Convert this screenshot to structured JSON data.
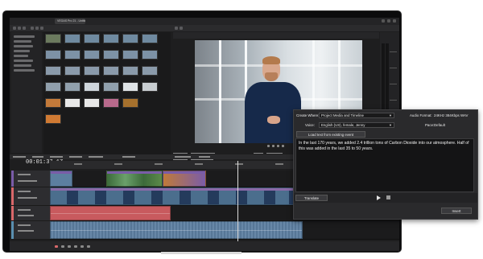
{
  "app": {
    "tab_title": "VEGAS Pro 21 - Untitled *"
  },
  "timeline": {
    "timecode": "00:01:37,17"
  },
  "tts_dialog": {
    "create_where_label": "Create Where:",
    "create_where_value": "Project Media and Timeline",
    "voice_label": "Voice:",
    "voice_value": "English (US), female, Jenny",
    "audio_format_label": "Audio Format:",
    "audio_format_value": "24KHz 384Kbps WAV",
    "pace_label": "Pace:",
    "pace_value": "Default",
    "load_button": "Load text from existing event",
    "text": "In the last 170 years, we added 2.4 trillion tons of Carbon Dioxide into our atmosphere. Half of this was added in the last 35 to 50 years.",
    "translate_button": "Translate",
    "insert_button": "Insert"
  },
  "icons": [
    "play-icon",
    "stop-icon",
    "chevron-down-icon"
  ],
  "colors": {
    "video_track": "#7a5ca8",
    "audio_track": "#d9686a",
    "accent": "#3aa34a"
  }
}
